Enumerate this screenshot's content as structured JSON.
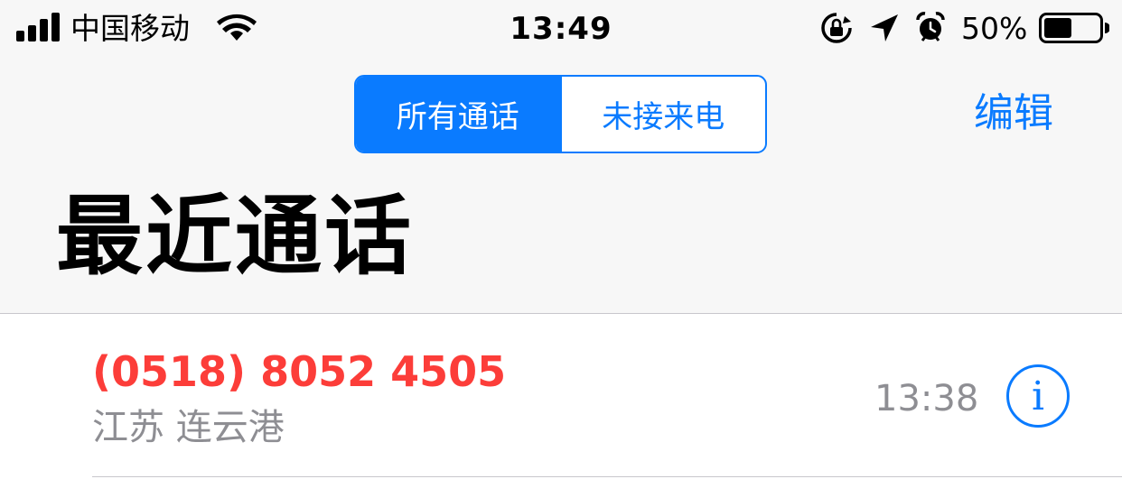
{
  "status_bar": {
    "carrier": "中国移动",
    "time": "13:49",
    "battery_percent": "50%",
    "battery_level": 0.5,
    "icons": [
      "signal-icon",
      "wifi-icon",
      "rotation-lock-icon",
      "location-icon",
      "alarm-icon",
      "battery-icon"
    ]
  },
  "nav": {
    "segments": [
      {
        "label": "所有通话",
        "selected": true
      },
      {
        "label": "未接来电",
        "selected": false
      }
    ],
    "edit_label": "编辑"
  },
  "page_title": "最近通话",
  "calls": [
    {
      "number": "(0518) 8052 4505",
      "location": "江苏 连云港",
      "time": "13:38",
      "missed": true,
      "info_icon": "info-icon"
    }
  ],
  "colors": {
    "accent": "#0a7bff",
    "missed": "#fc3d39",
    "secondary_text": "#8e8e93",
    "nav_background": "#f7f7f7"
  }
}
